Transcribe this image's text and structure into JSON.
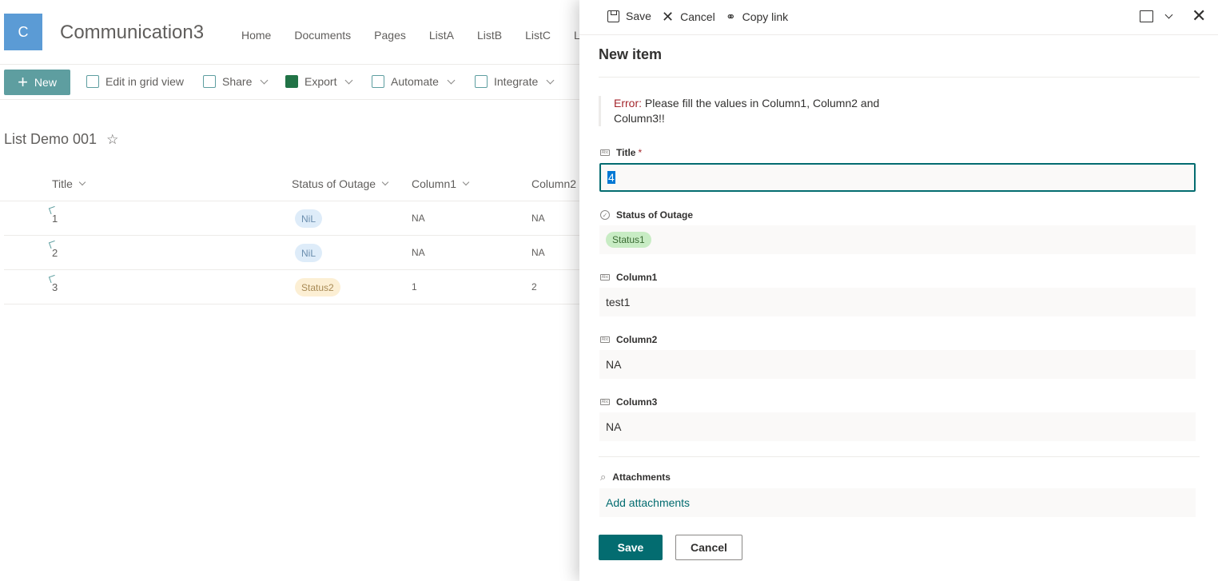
{
  "site": {
    "logo_letter": "C",
    "title": "Communication3",
    "nav": [
      "Home",
      "Documents",
      "Pages",
      "ListA",
      "ListB",
      "ListC",
      "Libr"
    ]
  },
  "commandbar": {
    "new_label": "New",
    "edit_grid": "Edit in grid view",
    "share": "Share",
    "export": "Export",
    "automate": "Automate",
    "integrate": "Integrate"
  },
  "list": {
    "title": "List Demo 001",
    "star": "☆",
    "columns": [
      "Title",
      "Status of Outage",
      "Column1",
      "Column2"
    ],
    "rows": [
      {
        "title": "1",
        "status": "NiL",
        "col1": "NA",
        "col2": "NA"
      },
      {
        "title": "2",
        "status": "NiL",
        "col1": "NA",
        "col2": "NA"
      },
      {
        "title": "3",
        "status": "Status2",
        "col1": "1",
        "col2": "2"
      }
    ]
  },
  "panel": {
    "save": "Save",
    "cancel": "Cancel",
    "copy_link": "Copy link",
    "title": "New item",
    "error_prefix": "Error:",
    "error_message": " Please fill the values in Column1, Column2 and Column3!!",
    "fields": {
      "title_label": "Title",
      "required_mark": "*",
      "title_value": "4",
      "status_label": "Status of Outage",
      "status_value": "Status1",
      "column1_label": "Column1",
      "column1_value": "test1",
      "column2_label": "Column2",
      "column2_value": "NA",
      "column3_label": "Column3",
      "column3_value": "NA",
      "attachments_label": "Attachments",
      "add_attachments": "Add attachments"
    },
    "save_button": "Save",
    "cancel_button": "Cancel"
  },
  "colors": {
    "accent": "#036c70",
    "new_button": "#5e9ea0",
    "error": "#a4262c",
    "logo": "#5b9bd5"
  }
}
